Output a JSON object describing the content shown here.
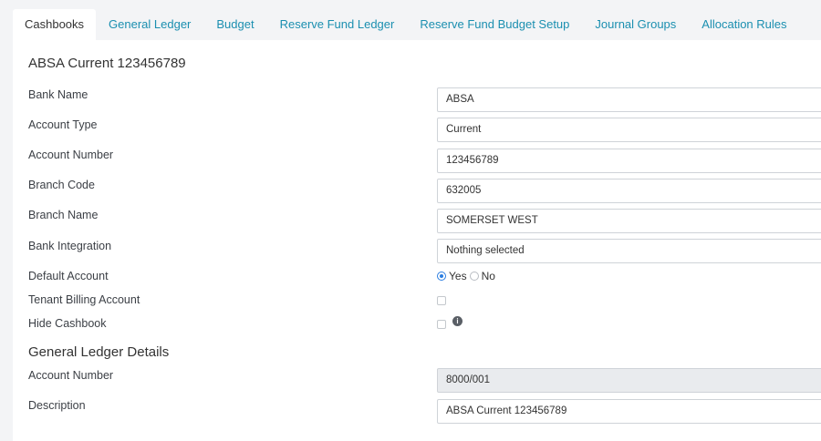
{
  "tabs": [
    {
      "label": "Cashbooks",
      "active": true
    },
    {
      "label": "General Ledger",
      "active": false
    },
    {
      "label": "Budget",
      "active": false
    },
    {
      "label": "Reserve Fund Ledger",
      "active": false
    },
    {
      "label": "Reserve Fund Budget Setup",
      "active": false
    },
    {
      "label": "Journal Groups",
      "active": false
    },
    {
      "label": "Allocation Rules",
      "active": false
    }
  ],
  "cashbook": {
    "title": "ABSA Current 123456789",
    "fields": {
      "bank_name": {
        "label": "Bank Name",
        "value": "ABSA"
      },
      "account_type": {
        "label": "Account Type",
        "value": "Current"
      },
      "account_number": {
        "label": "Account Number",
        "value": "123456789"
      },
      "branch_code": {
        "label": "Branch Code",
        "value": "632005"
      },
      "branch_name": {
        "label": "Branch Name",
        "value": "SOMERSET WEST"
      },
      "bank_integration": {
        "label": "Bank Integration",
        "value": "Nothing selected"
      }
    },
    "default_account": {
      "label": "Default Account",
      "yes_label": "Yes",
      "no_label": "No",
      "selected": "Yes"
    },
    "tenant_billing_account": {
      "label": "Tenant Billing Account",
      "checked": false
    },
    "hide_cashbook": {
      "label": "Hide Cashbook",
      "checked": false,
      "info_icon": "info-icon"
    }
  },
  "general_ledger": {
    "title": "General Ledger Details",
    "account_number": {
      "label": "Account Number",
      "value": "8000/001"
    },
    "description": {
      "label": "Description",
      "value": "ABSA Current 123456789"
    }
  },
  "colors": {
    "accent": "#1b8fb0",
    "radio_selected": "#2a7de1",
    "background": "#f3f4f6"
  }
}
